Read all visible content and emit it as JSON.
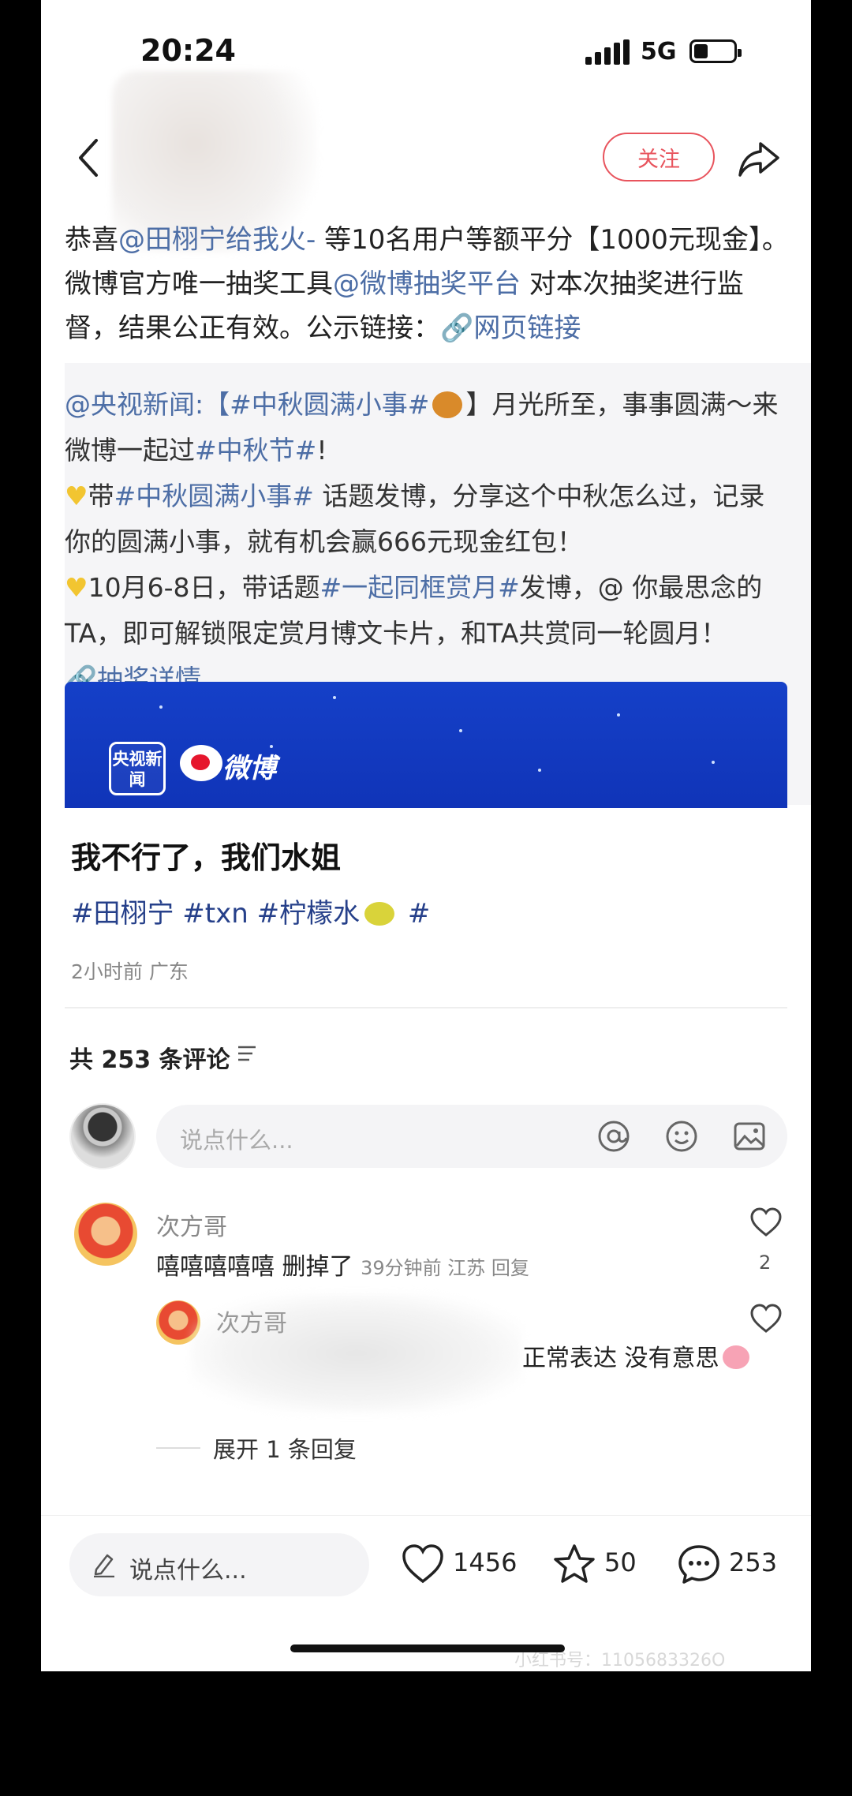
{
  "status": {
    "time": "20:24",
    "network": "5G",
    "battery_pct": 0.35
  },
  "header": {
    "follow_label": "关注"
  },
  "post": {
    "pre": "恭喜",
    "mention_user": "@田栩宁给我火-",
    "mid1": " 等10名用户等额平分【1000元现金】。微博官方唯一抽奖工具",
    "mention_platform": "@微博抽奖平台",
    "mid2": " 对本次抽奖进行监督，结果公正有效。公示链接：",
    "link_label": "网页链接"
  },
  "repost": {
    "source": "@央视新闻:",
    "tag_open": "【#中秋圆满小事#",
    "line1_end": "】月光所至，事事圆满～来微博一起过",
    "tag_festival": "#中秋节#",
    "line1_close": "!",
    "p2_pre": "带",
    "p2_tag": "#中秋圆满小事#",
    "p2_rest": " 话题发博，分享这个中秋怎么过，记录你的圆满小事，就有机会赢666元现金红包！",
    "p3_pre": "10月6-8日，带话题",
    "p3_tag": "#一起同框赏月#",
    "p3_rest": "发博，@ 你最思念的TA，即可解锁限定赏月博文卡片，和TA共赏同一轮圆月！",
    "detail_link": "抽奖详情",
    "banner_cctv": "央视新闻",
    "banner_weibo": "微博"
  },
  "note": {
    "title": "我不行了，我们水姐",
    "tags": "#田栩宁 #txn #柠檬水",
    "tags_end": " #",
    "time": "2小时前",
    "location": "广东"
  },
  "comments": {
    "header": "共 253 条评论",
    "input_placeholder": "说点什么...",
    "items": [
      {
        "name": "次方哥",
        "text": "嘻嘻嘻嘻嘻 删掉了",
        "meta": "39分钟前 江苏 回复",
        "likes": "2"
      },
      {
        "name": "次方哥",
        "text": "正常表达 没有意思"
      }
    ],
    "expand_label": "展开 1 条回复"
  },
  "bottom": {
    "input_placeholder": "说点什么...",
    "likes": "1456",
    "stars": "50",
    "comments": "253"
  },
  "watermark": "小红书号：1105683326O",
  "colors": {
    "accent": "#e8545d",
    "link": "#4d6ea6",
    "tag": "#26408a",
    "banner": "#1540c8"
  }
}
